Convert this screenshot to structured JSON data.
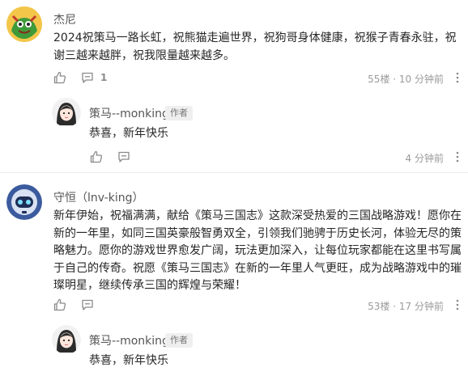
{
  "comments": [
    {
      "username": "杰尼",
      "text": "2024祝策马一路长虹，祝熊猫走遍世界，祝狗哥身体健康，祝猴子青春永驻，祝谢三越来越胖，祝我限量越来越多。",
      "reply_count": "1",
      "floor": "55楼",
      "time": "10 分钟前",
      "reply": {
        "username": "策马--monking",
        "badge": "作者",
        "text": "恭喜，新年快乐",
        "time": "4 分钟前"
      }
    },
    {
      "username": "守恒（lnv-king）",
      "text": "新年伊始，祝福满满，献给《策马三国志》这款深受热爱的三国战略游戏！愿你在新的一年里，如同三国英豪般智勇双全，引领我们驰骋于历史长河，体验无尽的策略魅力。愿你的游戏世界愈发广阔，玩法更加深入，让每位玩家都能在这里书写属于自己的传奇。祝愿《策马三国志》在新的一年里人气更旺，成为战略游戏中的璀璨明星，继续传承三国的辉煌与荣耀！",
      "floor": "53楼",
      "time": "17 分钟前",
      "reply": {
        "username": "策马--monking",
        "badge": "作者",
        "text": "恭喜，新年快乐"
      }
    }
  ]
}
